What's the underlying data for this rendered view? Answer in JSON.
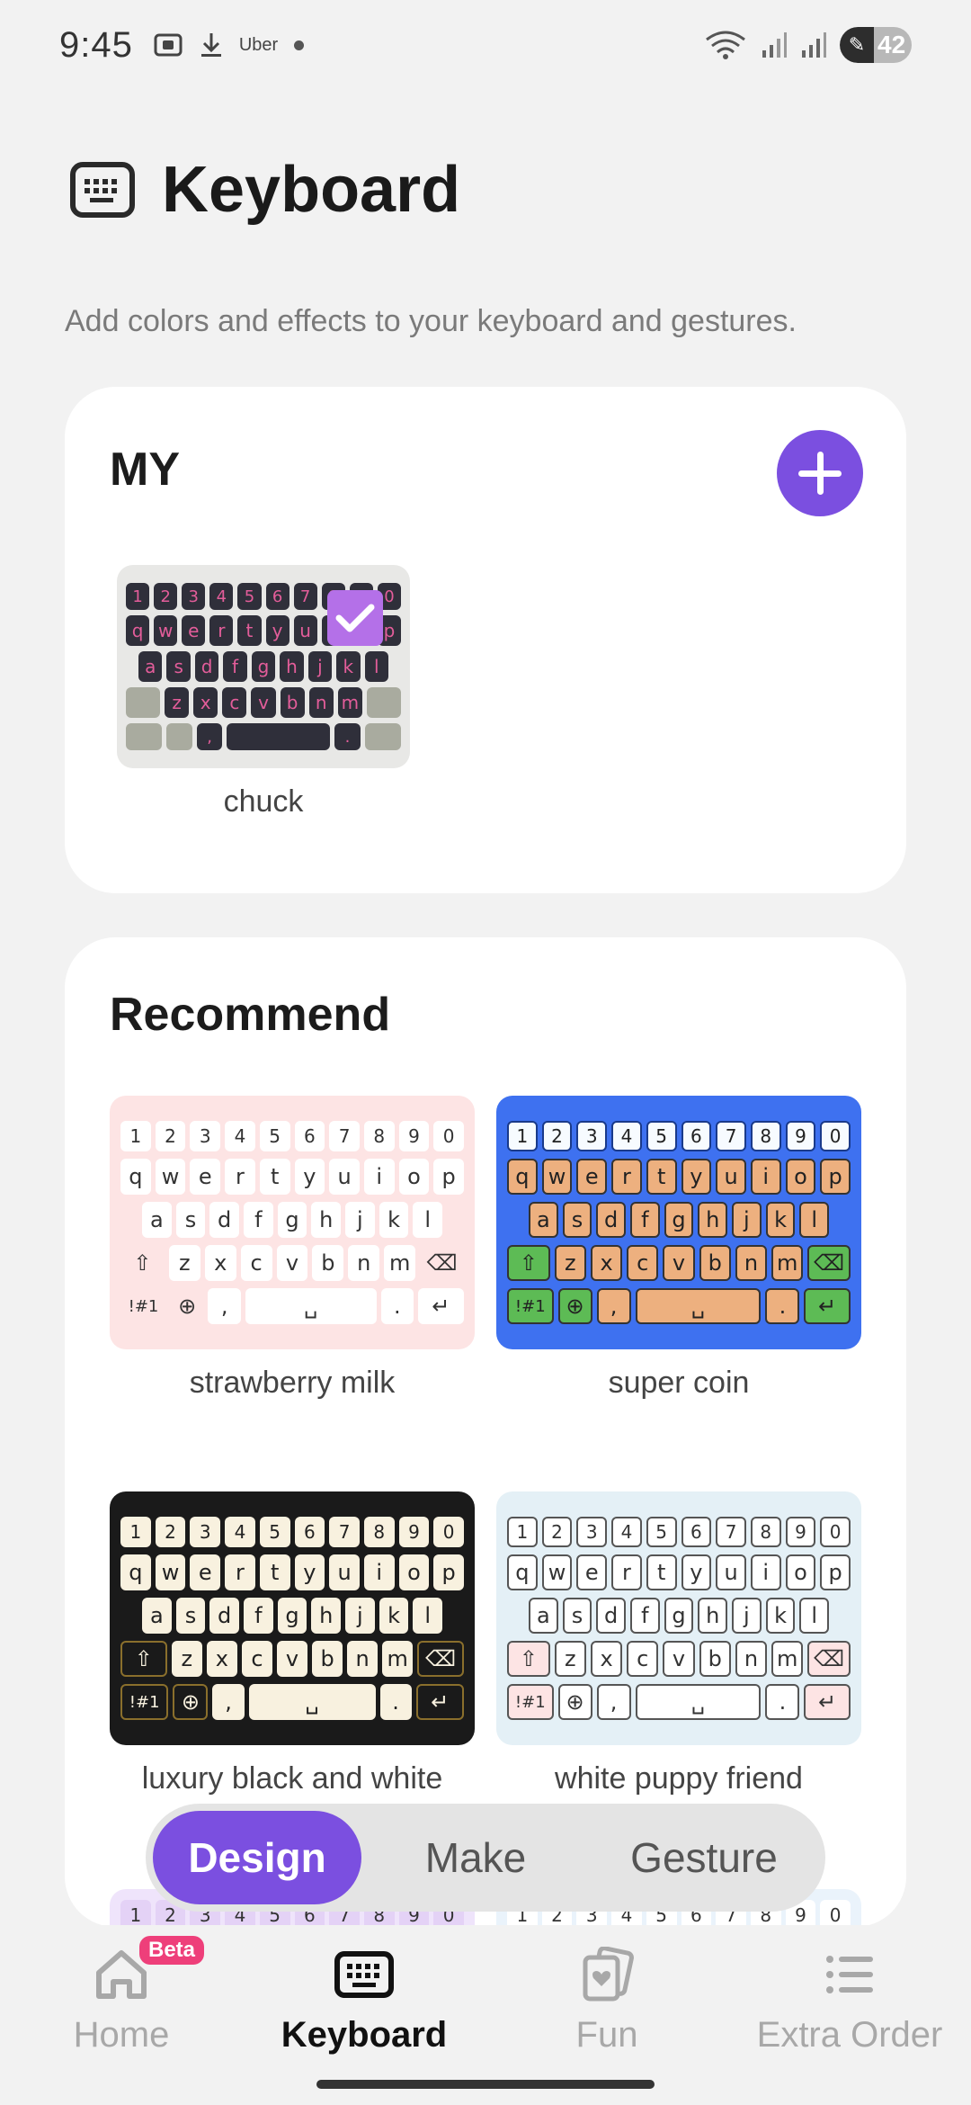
{
  "status_bar": {
    "time": "9:45",
    "uber": "Uber",
    "battery": "42"
  },
  "header": {
    "title": "Keyboard",
    "subtitle": "Add colors and effects to your keyboard and gestures."
  },
  "my_section": {
    "title": "MY",
    "themes": [
      {
        "name": "chuck",
        "selected": true
      }
    ]
  },
  "recommend": {
    "title": "Recommend",
    "themes": [
      {
        "name": "strawberry milk"
      },
      {
        "name": "super coin"
      },
      {
        "name": "luxury black and white"
      },
      {
        "name": "white puppy friend"
      }
    ]
  },
  "segments": {
    "options": [
      "Design",
      "Make",
      "Gesture"
    ],
    "active": "Design"
  },
  "nav": {
    "items": [
      {
        "label": "Home",
        "badge": "Beta"
      },
      {
        "label": "Keyboard"
      },
      {
        "label": "Fun"
      },
      {
        "label": "Extra Order"
      }
    ],
    "active": "Keyboard"
  },
  "keyboard": {
    "row1": [
      "1",
      "2",
      "3",
      "4",
      "5",
      "6",
      "7",
      "8",
      "9",
      "0"
    ],
    "row2": [
      "q",
      "w",
      "e",
      "r",
      "t",
      "y",
      "u",
      "i",
      "o",
      "p"
    ],
    "row3": [
      "a",
      "s",
      "d",
      "f",
      "g",
      "h",
      "j",
      "k",
      "l"
    ],
    "row4": [
      "z",
      "x",
      "c",
      "v",
      "b",
      "n",
      "m"
    ],
    "sym": "!#1",
    "comma": ",",
    "period": "."
  },
  "colors": {
    "accent": "#7b4fe0",
    "beta_badge": "#ee3f7a"
  }
}
